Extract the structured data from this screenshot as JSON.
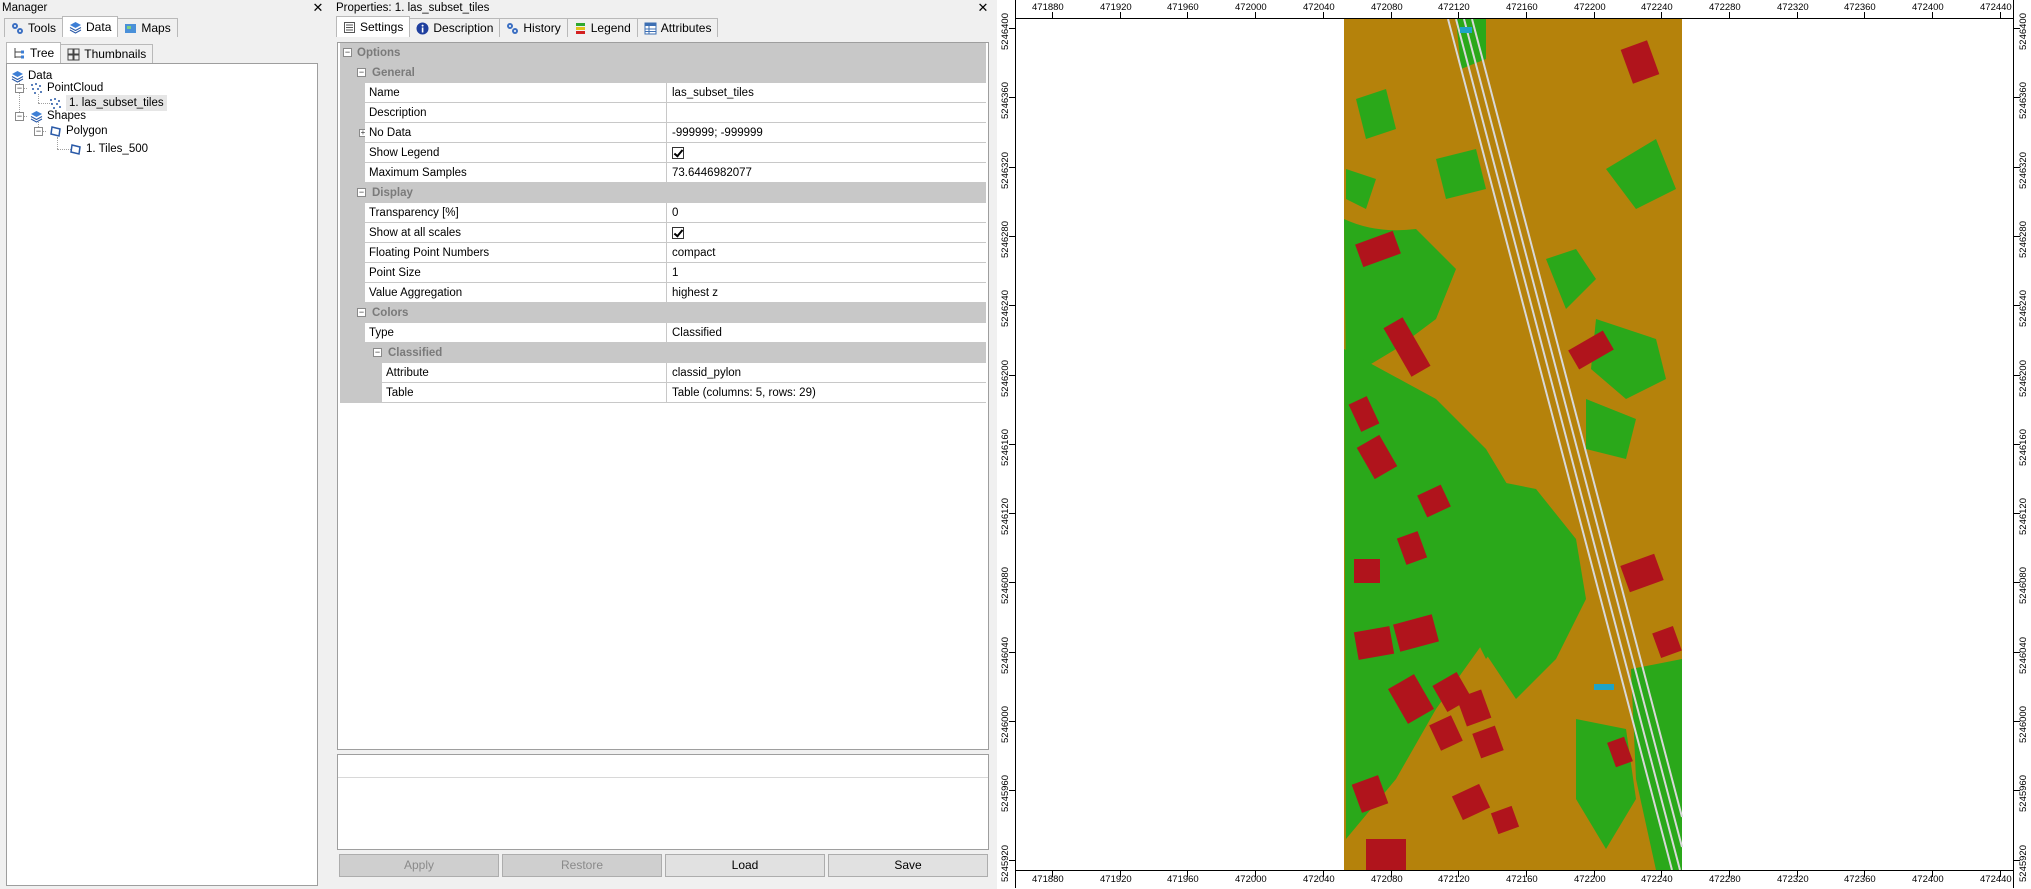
{
  "manager": {
    "title": "Manager",
    "tabs": [
      {
        "label": "Tools",
        "icon": "tools-icon"
      },
      {
        "label": "Data",
        "icon": "data-icon",
        "active": true
      },
      {
        "label": "Maps",
        "icon": "maps-icon"
      }
    ],
    "subtabs": [
      {
        "label": "Tree",
        "icon": "tree-icon",
        "active": true
      },
      {
        "label": "Thumbnails",
        "icon": "thumbnails-icon"
      }
    ],
    "tree": {
      "root": "Data",
      "pointcloud_group": "PointCloud",
      "pointcloud_item": "1. las_subset_tiles",
      "shapes_group": "Shapes",
      "polygon_group": "Polygon",
      "polygon_item": "1. Tiles_500"
    }
  },
  "properties": {
    "title": "Properties:  1. las_subset_tiles",
    "tabs": [
      {
        "label": "Settings",
        "icon": "settings-icon",
        "active": true
      },
      {
        "label": "Description",
        "icon": "info-icon"
      },
      {
        "label": "History",
        "icon": "history-icon"
      },
      {
        "label": "Legend",
        "icon": "legend-icon"
      },
      {
        "label": "Attributes",
        "icon": "attributes-icon"
      }
    ],
    "sections": {
      "options": "Options",
      "general": "General",
      "display": "Display",
      "colors": "Colors",
      "classified": "Classified"
    },
    "general": {
      "name_label": "Name",
      "name_value": "las_subset_tiles",
      "description_label": "Description",
      "description_value": "",
      "nodata_label": "No Data",
      "nodata_value": "-999999; -999999",
      "show_legend_label": "Show Legend",
      "show_legend_checked": true,
      "max_samples_label": "Maximum Samples",
      "max_samples_value": "73.6446982077"
    },
    "display": {
      "transparency_label": "Transparency [%]",
      "transparency_value": "0",
      "show_all_scales_label": "Show at all scales",
      "show_all_scales_checked": true,
      "floating_label": "Floating Point Numbers",
      "floating_value": "compact",
      "point_size_label": "Point Size",
      "point_size_value": "1",
      "aggregation_label": "Value Aggregation",
      "aggregation_value": "highest z"
    },
    "colors": {
      "type_label": "Type",
      "type_value": "Classified",
      "attribute_label": "Attribute",
      "attribute_value": "classid_pylon",
      "table_label": "Table",
      "table_value": "Table (columns: 5, rows: 29)"
    },
    "buttons": {
      "apply": "Apply",
      "restore": "Restore",
      "load": "Load",
      "save": "Save"
    }
  },
  "map": {
    "x_ticks": [
      "471880",
      "471920",
      "471960",
      "472000",
      "472040",
      "472080",
      "472120",
      "472160",
      "472200",
      "472240",
      "472280",
      "472320",
      "472360",
      "472400",
      "472440"
    ],
    "y_ticks": [
      "5246400",
      "5246360",
      "5246320",
      "5246280",
      "5246240",
      "5246200",
      "5246160",
      "5246120",
      "5246080",
      "5246040",
      "5246000",
      "5245960",
      "5245920"
    ],
    "colors": {
      "ground": "#b5820b",
      "vegetation": "#2aa81a",
      "building": "#b0141c",
      "power_line": "#d8d8d8",
      "water": "#1ea3c8"
    }
  }
}
